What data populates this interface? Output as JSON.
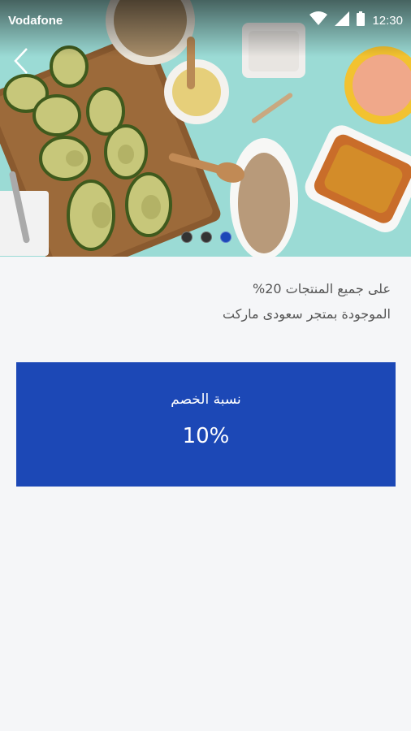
{
  "status_bar": {
    "carrier": "Vodafone",
    "time": "12:30",
    "icons": [
      "wifi-icon",
      "signal-icon",
      "battery-icon"
    ]
  },
  "hero": {
    "carousel": {
      "count": 3,
      "active_index": 2
    },
    "accent_color": "#1c48b8"
  },
  "offer": {
    "line1": "على جميع المنتجات 20%",
    "line2": "الموجودة بمتجر سعودى ماركت"
  },
  "discount": {
    "label": "نسبة الخصم",
    "value": "10%",
    "color": "#1c48b6"
  }
}
